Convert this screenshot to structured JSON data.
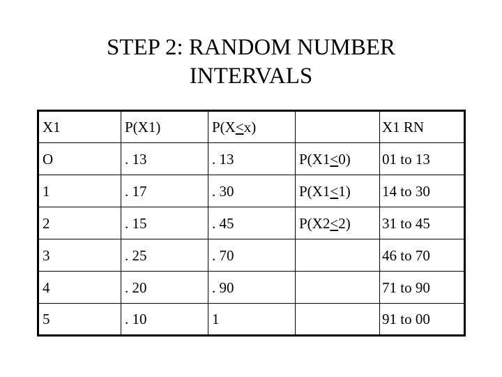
{
  "slide": {
    "title": "STEP 2: RANDOM NUMBER\nINTERVALS",
    "background_color": "#ffffff",
    "text_color": "#000000",
    "border_color": "#000000"
  },
  "table": {
    "headers": [
      "X1",
      "P(X1)",
      "P(X≤x)",
      "",
      "X1 RN"
    ],
    "header_parts": {
      "col3_prefix": "P(X",
      "col3_le": "<",
      "col3_suffix": "x)"
    },
    "rows": [
      {
        "x1": "O",
        "p_x1": ". 13",
        "p_cum": ". 13",
        "cdf_prefix": "P(X1",
        "cdf_le": "<",
        "cdf_suffix": "0)",
        "cdf": "P(X1≤0)",
        "rn": "01 to 13"
      },
      {
        "x1": "1",
        "p_x1": ". 17",
        "p_cum": ". 30",
        "cdf_prefix": "P(X1",
        "cdf_le": "<",
        "cdf_suffix": "1)",
        "cdf": "P(X1≤1)",
        "rn": "14 to 30"
      },
      {
        "x1": "2",
        "p_x1": ". 15",
        "p_cum": ". 45",
        "cdf_prefix": "P(X2",
        "cdf_le": "<",
        "cdf_suffix": "2)",
        "cdf": "P(X2≤2)",
        "rn": "31 to 45"
      },
      {
        "x1": "3",
        "p_x1": ". 25",
        "p_cum": ". 70",
        "cdf_prefix": "",
        "cdf_le": "",
        "cdf_suffix": "",
        "cdf": "",
        "rn": "46 to 70"
      },
      {
        "x1": "4",
        "p_x1": ". 20",
        "p_cum": ". 90",
        "cdf_prefix": "",
        "cdf_le": "",
        "cdf_suffix": "",
        "cdf": "",
        "rn": "71 to 90"
      },
      {
        "x1": "5",
        "p_x1": ". 10",
        "p_cum": "1",
        "cdf_prefix": "",
        "cdf_le": "",
        "cdf_suffix": "",
        "cdf": "",
        "rn": "91 to 00"
      }
    ]
  }
}
